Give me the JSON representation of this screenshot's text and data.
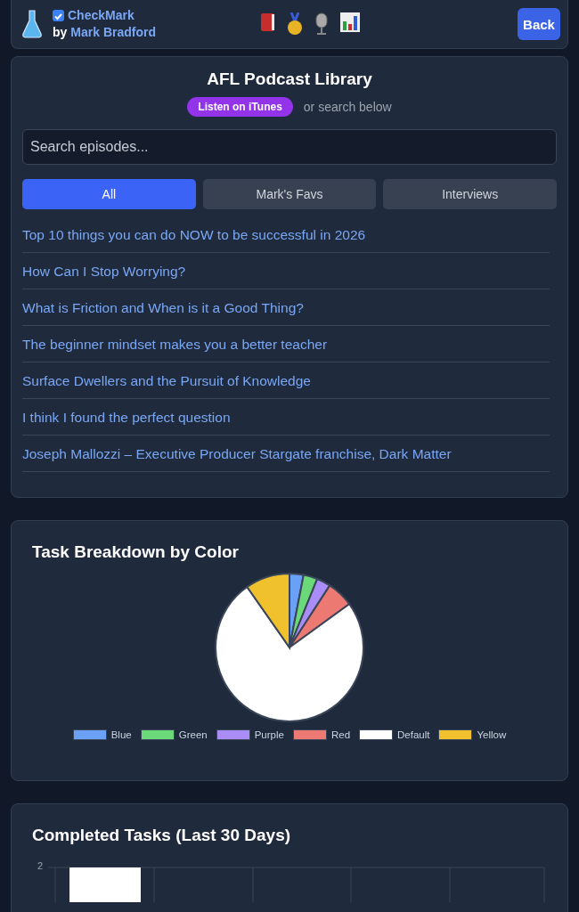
{
  "header": {
    "checked": true,
    "app_name": "CheckMark",
    "by": "by",
    "author": "Mark Bradford",
    "back": "Back"
  },
  "podcast": {
    "title": "AFL Podcast Library",
    "itunes": "Listen on iTunes",
    "hint": "or search below",
    "search": {
      "placeholder": "Search episodes..."
    },
    "tabs": [
      {
        "label": "All",
        "selected": true
      },
      {
        "label": "Mark's Favs",
        "selected": false
      },
      {
        "label": "Interviews",
        "selected": false
      }
    ],
    "episodes": [
      "Top 10 things you can do NOW to be successful in 2026",
      "How Can I Stop Worrying?",
      "What is Friction and When is it a Good Thing?",
      "The beginner mindset makes you a better teacher",
      "Surface Dwellers and the Pursuit of Knowledge",
      "I think I found the perfect question",
      "Joseph Mallozzi – Executive Producer Stargate franchise, Dark Matter"
    ]
  },
  "breakdown": {
    "title": "Task Breakdown by Color",
    "legend": [
      {
        "label": "Blue",
        "color": "#6aa1f7"
      },
      {
        "label": "Green",
        "color": "#6bd97a"
      },
      {
        "label": "Purple",
        "color": "#a98cf5"
      },
      {
        "label": "Red",
        "color": "#ec7a72"
      },
      {
        "label": "Default",
        "color": "#ffffff"
      },
      {
        "label": "Yellow",
        "color": "#f0c02d"
      }
    ]
  },
  "completed": {
    "title": "Completed Tasks (Last 30 Days)",
    "y_tick": "2"
  }
}
